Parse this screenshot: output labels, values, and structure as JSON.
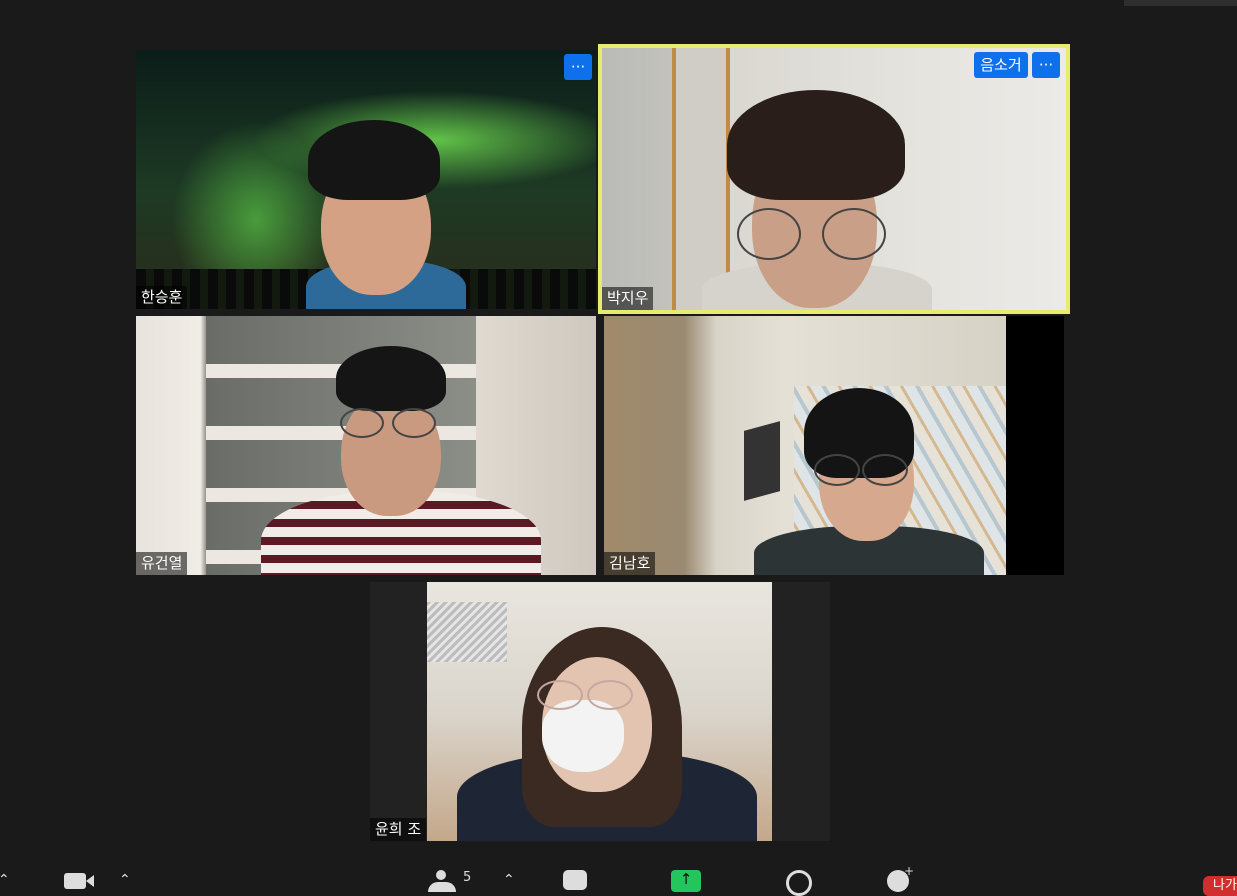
{
  "participants": [
    {
      "name": "한승훈",
      "has_more_button": true,
      "more_label": "···"
    },
    {
      "name": "박지우",
      "has_more_button": true,
      "more_label": "···",
      "remove_label": "음소거",
      "active_speaker": true
    },
    {
      "name": "유건열"
    },
    {
      "name": "김남호"
    },
    {
      "name": "윤희 조"
    }
  ],
  "toolbar": {
    "participants_count": "5",
    "leave_label": "나가"
  },
  "colors": {
    "background": "#1a1a1a",
    "accent_blue": "#0e71eb",
    "active_speaker_border": "#e8ec6e",
    "share_green": "#22c55e",
    "leave_red": "#d12f2f"
  }
}
